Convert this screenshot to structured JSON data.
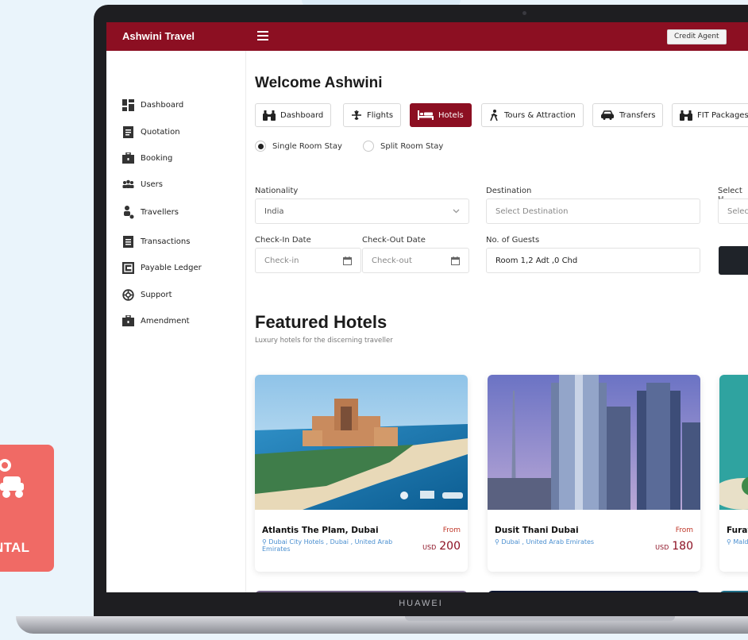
{
  "app": {
    "title": "Ashwini Travel",
    "role": "Credit Agent"
  },
  "device": {
    "brand": "HUAWEI"
  },
  "badge": {
    "label": "NTAL"
  },
  "sidebar": {
    "items": [
      {
        "label": "Dashboard",
        "icon": "dashboard-icon"
      },
      {
        "label": "Quotation",
        "icon": "document-icon"
      },
      {
        "label": "Booking",
        "icon": "briefcase-icon"
      },
      {
        "label": "Users",
        "icon": "users-icon"
      },
      {
        "label": "Travellers",
        "icon": "traveller-icon"
      },
      {
        "label": "Transactions",
        "icon": "list-icon"
      },
      {
        "label": "Payable Ledger",
        "icon": "ledger-icon"
      },
      {
        "label": "Support",
        "icon": "lifebuoy-icon"
      },
      {
        "label": "Amendment",
        "icon": "briefcase-icon"
      }
    ]
  },
  "main": {
    "welcome": "Welcome Ashwini",
    "tabs": [
      {
        "label": "Dashboard",
        "icon": "binoculars-icon",
        "active": false
      },
      {
        "label": "Flights",
        "icon": "plane-icon",
        "active": false
      },
      {
        "label": "Hotels",
        "icon": "bed-icon",
        "active": true
      },
      {
        "label": "Tours & Attraction",
        "icon": "hiker-icon",
        "active": false
      },
      {
        "label": "Transfers",
        "icon": "car-icon",
        "active": false
      },
      {
        "label": "FIT Packages",
        "icon": "binoculars-icon",
        "active": false
      }
    ],
    "stay": {
      "single": "Single Room Stay",
      "split": "Split Room Stay",
      "selected": "single"
    },
    "form": {
      "nationality_label": "Nationality",
      "nationality_value": "India",
      "destination_label": "Destination",
      "destination_placeholder": "Select Destination",
      "hotel_label": "Select H",
      "hotel_placeholder": "Selec",
      "checkin_label": "Check-In Date",
      "checkin_placeholder": "Check-in",
      "checkout_label": "Check-Out Date",
      "checkout_placeholder": "Check-out",
      "guests_label": "No. of Guests",
      "guests_value": "Room 1,2 Adt ,0 Chd"
    },
    "featured": {
      "title": "Featured Hotels",
      "subtitle": "Luxury hotels for the discerning traveller",
      "hotels": [
        {
          "name": "Atlantis The Plam, Dubai",
          "location": "Dubai City Hotels , Dubai , United Arab Emirates",
          "from": "From",
          "currency": "USD",
          "price": "200"
        },
        {
          "name": "Dusit Thani Dubai",
          "location": "Dubai , United Arab Emirates",
          "from": "From",
          "currency": "USD",
          "price": "180"
        },
        {
          "name": "Furav",
          "location": "Mald"
        }
      ]
    }
  },
  "colors": {
    "brand": "#8c0f22",
    "accent_link": "#4a8fd0",
    "badge": "#f06a65"
  }
}
